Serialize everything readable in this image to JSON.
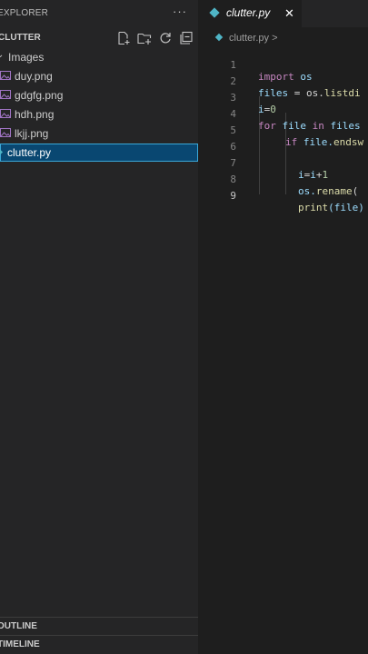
{
  "sidebar": {
    "explorer_title": "EXPLORER",
    "more_icon": "ellipsis-icon",
    "folder_name": "CLUTTER",
    "toolbar_icons": [
      "new-file-icon",
      "new-folder-icon",
      "refresh-icon",
      "collapse-all-icon"
    ],
    "tree": [
      {
        "label": "Images",
        "type": "folder",
        "expanded": true
      },
      {
        "label": "duy.png",
        "type": "image"
      },
      {
        "label": "gdgfg.png",
        "type": "image"
      },
      {
        "label": "hdh.png",
        "type": "image"
      },
      {
        "label": "lkjj.png",
        "type": "image"
      },
      {
        "label": "clutter.py",
        "type": "python",
        "selected": true
      }
    ],
    "outline_label": "OUTLINE",
    "timeline_label": "TIMELINE"
  },
  "editor": {
    "tab_label": "clutter.py",
    "tab_close": "✕",
    "breadcrumb": "clutter.py >",
    "line_numbers": [
      "1",
      "2",
      "3",
      "4",
      "5",
      "6",
      "7",
      "8",
      "9"
    ],
    "code": {
      "l1_kw": "import",
      "l1_mod": " os",
      "l2_var": "files",
      "l2_rest": " = os.",
      "l2_fn": "listdi",
      "l3_var": "i",
      "l3_op": "=",
      "l3_num": "0",
      "l4_kw": "for",
      "l4_var": " file ",
      "l4_kw2": "in",
      "l4_rest": " files",
      "l5_kw": "if",
      "l5_var": " file.",
      "l5_fn": "endsw",
      "l7_var": "i",
      "l7_op": "=",
      "l7_var2": "i",
      "l7_op2": "+",
      "l7_num": "1",
      "l8_var": "os.",
      "l8_fn": "rename",
      "l8_rest": "(",
      "l9_fn": "print",
      "l9_rest": "(file)"
    }
  },
  "colors": {
    "sidebar_bg": "#252526",
    "editor_bg": "#1e1e1e",
    "selection": "#094771",
    "keyword": "#c586c0",
    "variable": "#9cdcfe",
    "function": "#dcdcaa",
    "number": "#b5cea8"
  }
}
